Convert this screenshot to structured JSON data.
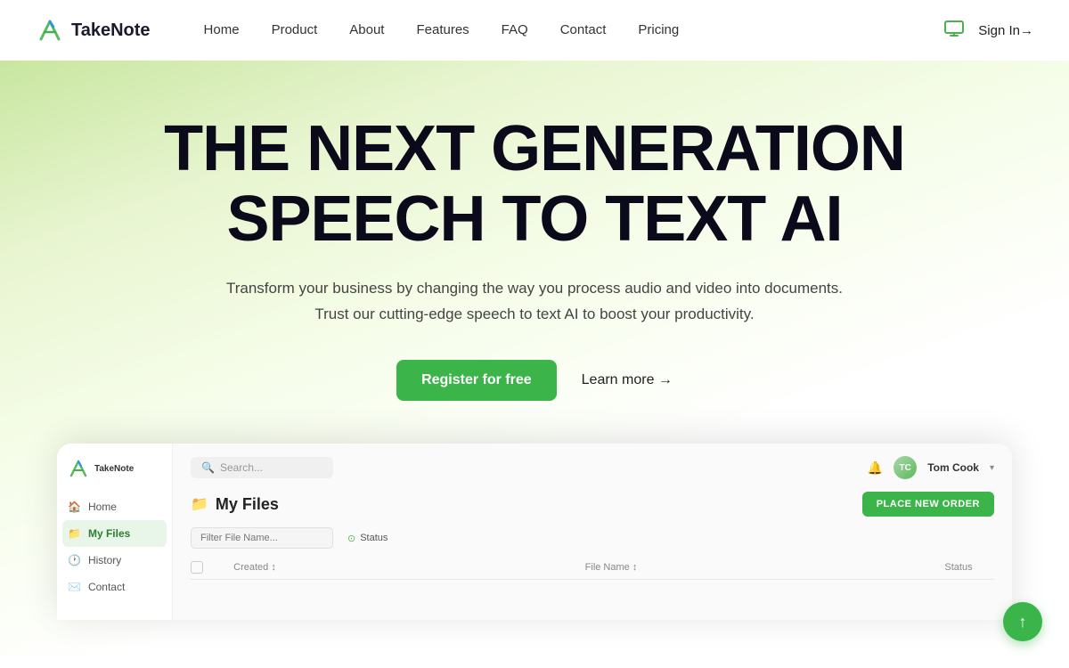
{
  "brand": {
    "name": "TakeNote",
    "logo_alt": "TakeNote logo"
  },
  "nav": {
    "links": [
      {
        "label": "Home",
        "id": "home"
      },
      {
        "label": "Product",
        "id": "product"
      },
      {
        "label": "About",
        "id": "about"
      },
      {
        "label": "Features",
        "id": "features"
      },
      {
        "label": "FAQ",
        "id": "faq"
      },
      {
        "label": "Contact",
        "id": "contact"
      },
      {
        "label": "Pricing",
        "id": "pricing"
      }
    ],
    "sign_in": "Sign In→"
  },
  "hero": {
    "title_line1": "THE NEXT GENERATION",
    "title_line2": "SPEECH TO TEXT AI",
    "subtitle_line1": "Transform your business by changing the way you process audio and video into documents.",
    "subtitle_line2": "Trust our cutting-edge speech to text AI to boost your productivity.",
    "cta_primary": "Register for free",
    "cta_secondary": "Learn more →"
  },
  "app_preview": {
    "logo_text": "TakeNote",
    "search_placeholder": "Search...",
    "user_name": "Tom Cook",
    "nav_items": [
      {
        "label": "Home",
        "icon": "🏠",
        "active": false
      },
      {
        "label": "My Files",
        "icon": "📁",
        "active": true
      },
      {
        "label": "History",
        "icon": "🕐",
        "active": false
      },
      {
        "label": "Contact",
        "icon": "✉️",
        "active": false
      }
    ],
    "page_title": "My Files",
    "place_order_btn": "PLACE NEW ORDER",
    "filter_placeholder": "Filter File Name...",
    "status_filter_label": "Status",
    "table_headers": {
      "checkbox": "",
      "created": "Created ↕",
      "filename": "File Name ↕",
      "status": "Status"
    }
  },
  "scroll_up_icon": "↑"
}
